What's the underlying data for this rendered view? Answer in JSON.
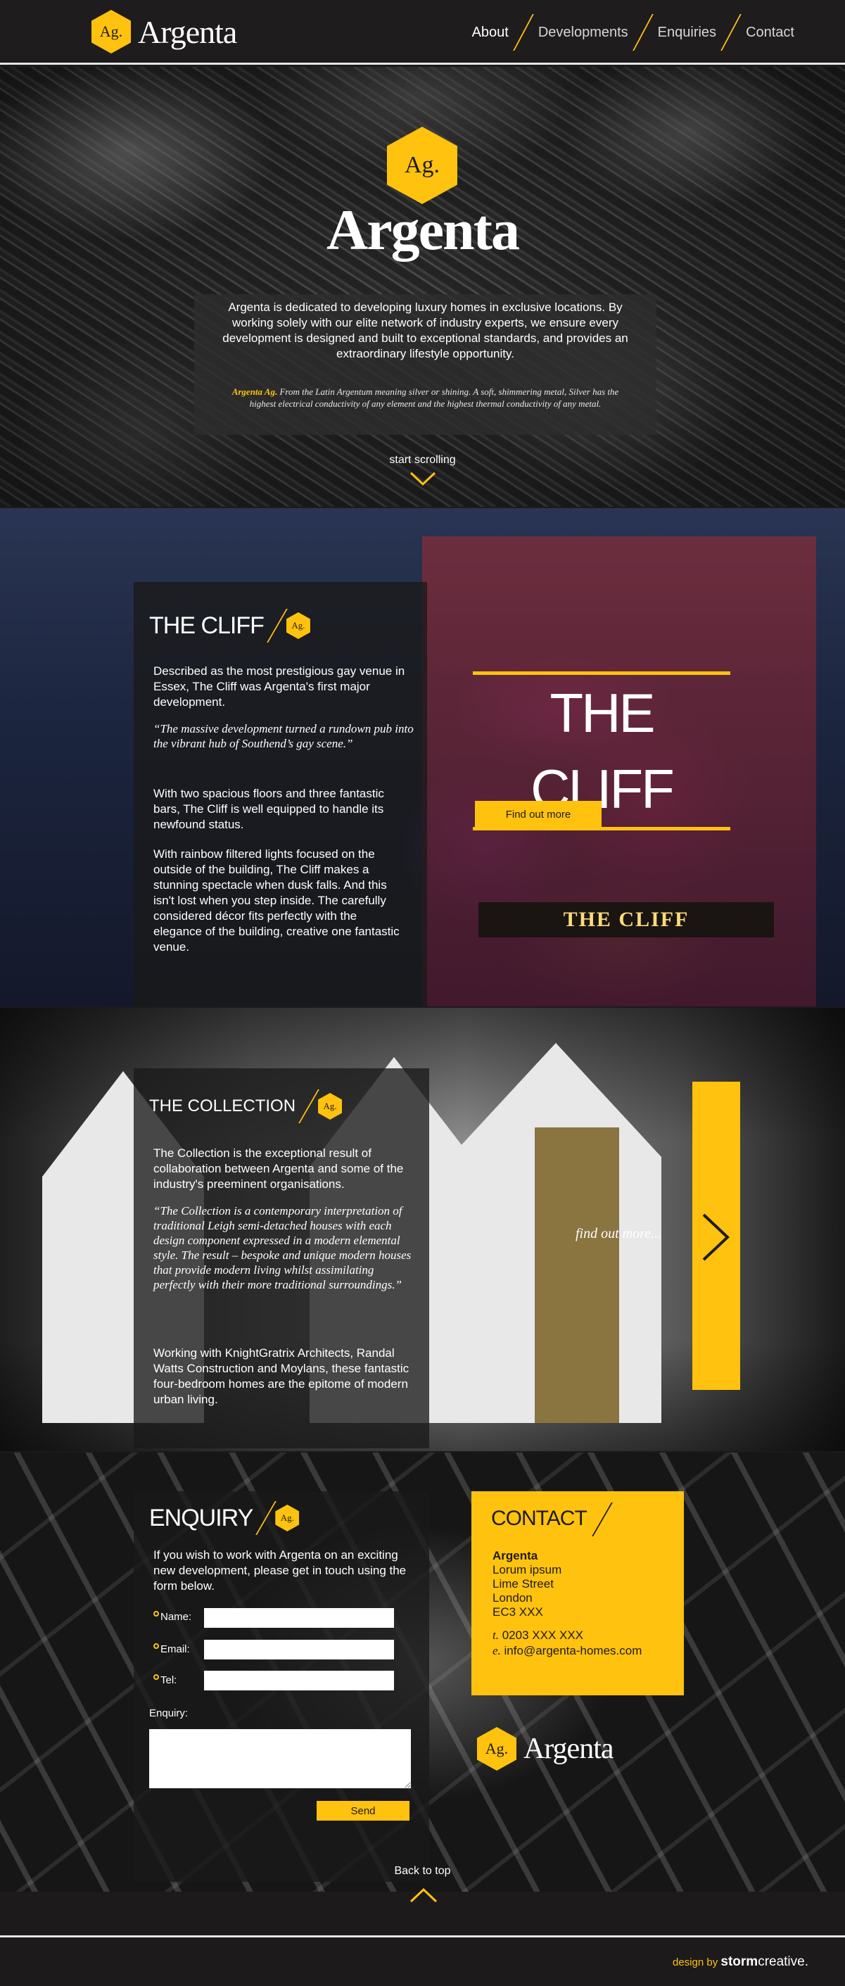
{
  "brand": {
    "logo_mark": "Ag.",
    "name": "Argenta"
  },
  "nav": {
    "items": [
      {
        "label": "About",
        "active": true
      },
      {
        "label": "Developments"
      },
      {
        "label": "Enquiries"
      },
      {
        "label": "Contact"
      }
    ]
  },
  "hero": {
    "logo_mark": "Ag.",
    "title": "Argenta",
    "intro": "Argenta is dedicated to developing luxury homes in exclusive locations. By working solely with our elite network of industry experts, we ensure every development is designed and built to exceptional standards, and provides an extraordinary lifestyle opportunity.",
    "definition_term": "Argenta Ag.",
    "definition_text": " From the Latin Argentum meaning silver or shining. A soft, shimmering metal, Silver has the highest electrical conductivity of any element and the highest thermal conductivity of any metal.",
    "scroll_label": "start scrolling"
  },
  "cliff": {
    "title": "THE CLIFF",
    "logo_mark": "Ag.",
    "p1": "Described as the most prestigious gay venue in Essex, The Cliff was Argenta's first major development.",
    "quote": "“The massive development turned a rundown pub into the vibrant hub of Southend’s gay scene.”",
    "p2": "With two spacious floors and three fantastic bars, The Cliff is well equipped to handle its newfound status.",
    "p3": "With rainbow filtered lights focused on the outside of the building, The Cliff makes a stunning spectacle when dusk falls. And this isn't lost when you step inside. The carefully considered décor fits perfectly with the elegance of the building, creative one fantastic venue.",
    "banner_title": "THE CLIFF",
    "button_label": "Find out more",
    "sign_text": "THE CLIFF"
  },
  "collection": {
    "title": "THE COLLECTION",
    "logo_mark": "Ag.",
    "p1": "The Collection is the exceptional result of collaboration between Argenta and some of the industry's preeminent organisations.",
    "quote": "“The Collection is a contemporary interpretation of traditional Leigh semi-detached houses with each design component expressed in a modern elemental style. The result – bespoke and unique modern houses that provide modern living whilst assimilating perfectly with their more traditional surroundings.”",
    "p2": "Working with KnightGratrix Architects, Randal Watts Construction and Moylans, these fantastic four-bedroom homes are the epitome of modern urban living.",
    "find_more": "find out more..."
  },
  "enquiry": {
    "title": "ENQUIRY",
    "logo_mark": "Ag.",
    "intro": "If you wish to work with Argenta on an exciting new development, please get in touch using the form below.",
    "fields": [
      {
        "label": "Name:",
        "value": ""
      },
      {
        "label": "Email:",
        "value": ""
      },
      {
        "label": "Tel:",
        "value": ""
      }
    ],
    "enquiry_label": "Enquiry:",
    "send_label": "Send"
  },
  "contact": {
    "title": "CONTACT",
    "company": "Argenta",
    "address": [
      "Lorum ipsum",
      "Lime Street",
      "London",
      "EC3 XXX"
    ],
    "phone_prefix": "t.",
    "phone": "0203 XXX XXX",
    "email_prefix": "e.",
    "email": "info@argenta-homes.com"
  },
  "footer_logo": {
    "logo_mark": "Ag.",
    "name": "Argenta"
  },
  "back_to_top": "Back to top",
  "credit": {
    "prefix": "design by ",
    "brand_bold": "storm",
    "brand_rest": "creative."
  },
  "colors": {
    "accent": "#ffc20e",
    "dark": "#1f1c1d"
  }
}
